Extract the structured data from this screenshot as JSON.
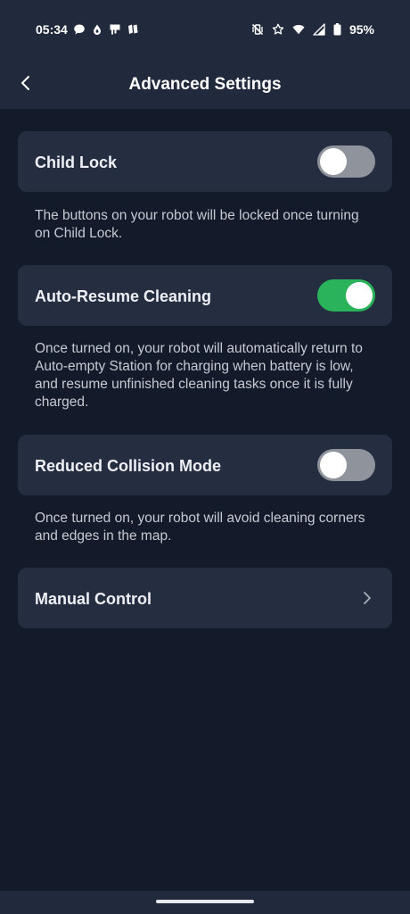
{
  "status_bar": {
    "time": "05:34",
    "battery": "95%",
    "left_icons": [
      "chat-bubble-icon",
      "drop-icon",
      "flag-icon",
      "notes-icon"
    ],
    "right_icons": [
      "vibrate-off-icon",
      "star-icon",
      "wifi-icon",
      "cell-signal-icon",
      "battery-icon"
    ]
  },
  "header": {
    "title": "Advanced Settings",
    "back_icon": "chevron-left-icon"
  },
  "settings": [
    {
      "label": "Child Lock",
      "enabled": false,
      "description": "The buttons on your robot will be locked once turning on Child Lock."
    },
    {
      "label": "Auto-Resume Cleaning",
      "enabled": true,
      "description": "Once turned on, your robot will automatically return to Auto-empty Station for charging when battery is low, and resume unfinished cleaning tasks once it is fully charged."
    },
    {
      "label": "Reduced Collision Mode",
      "enabled": false,
      "description": "Once turned on, your robot will avoid cleaning corners and edges in the map."
    }
  ],
  "manual_control": {
    "label": "Manual Control",
    "icon": "chevron-right-icon"
  },
  "colors": {
    "background": "#131a29",
    "card": "#252e40",
    "toggle_on": "#2ab35a",
    "toggle_off": "#8f939b"
  }
}
